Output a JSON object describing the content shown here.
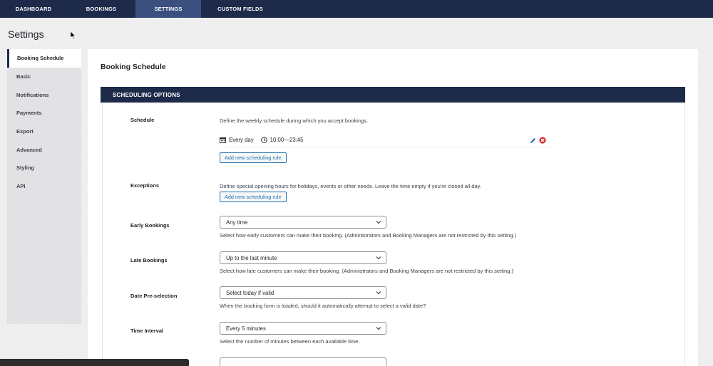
{
  "nav": {
    "tabs": [
      {
        "label": "DASHBOARD"
      },
      {
        "label": "BOOKINGS"
      },
      {
        "label": "SETTINGS",
        "active": true
      },
      {
        "label": "CUSTOM FIELDS"
      }
    ]
  },
  "page": {
    "title": "Settings"
  },
  "sidebar": {
    "items": [
      {
        "label": "Booking Schedule",
        "active": true
      },
      {
        "label": "Basic"
      },
      {
        "label": "Notifications"
      },
      {
        "label": "Payments"
      },
      {
        "label": "Export"
      },
      {
        "label": "Advanced"
      },
      {
        "label": "Styling"
      },
      {
        "label": "API"
      }
    ]
  },
  "main": {
    "section_title": "Booking Schedule",
    "panel_title": "SCHEDULING OPTIONS",
    "schedule": {
      "label": "Schedule",
      "description": "Define the weekly schedule during which you accept bookings.",
      "rule_days": "Every day",
      "rule_time": "10:00—23:45",
      "add_button": "Add new scheduling rule"
    },
    "exceptions": {
      "label": "Exceptions",
      "description": "Define special opening hours for holidays, events or other needs. Leave the time empty if you're closed all day.",
      "add_button": "Add new scheduling rule"
    },
    "early_bookings": {
      "label": "Early Bookings",
      "value": "Any time",
      "description": "Select how early customers can make their booking. (Administrators and Booking Managers are not restricted by this setting.)"
    },
    "late_bookings": {
      "label": "Late Bookings",
      "value": "Up to the last minute",
      "description": "Select how late customers can make their booking. (Administrators and Booking Managers are not restricted by this setting.)"
    },
    "date_preselection": {
      "label": "Date Pre-selection",
      "value": "Select today if valid",
      "description": "When the booking form is loaded, should it automatically attempt to select a valid date?"
    },
    "time_interval": {
      "label": "Time Interval",
      "value": "Every 5 minutes",
      "description": "Select the number of minutes between each available time."
    }
  },
  "colors": {
    "nav_bg": "#1e2a4a",
    "accent": "#2271b1",
    "delete": "#d63638"
  },
  "icons": [
    "calendar-icon",
    "clock-icon",
    "edit-icon",
    "delete-icon",
    "chevron-down-icon",
    "mouse-cursor-icon"
  ]
}
